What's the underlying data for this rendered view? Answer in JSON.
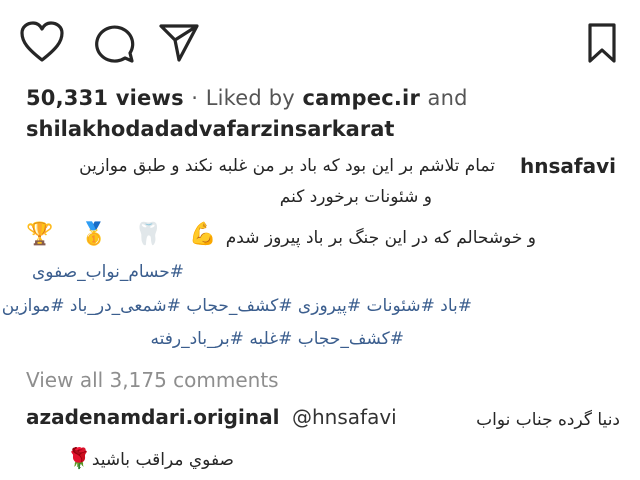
{
  "actions": {
    "like": "heart-icon",
    "comment": "comment-icon",
    "share": "share-icon",
    "save": "bookmark-icon"
  },
  "stats": {
    "views": "50,331 views",
    "separator": "·",
    "liked_by_prefix": "Liked by",
    "liked_by_user": "campec.ir",
    "and": "and",
    "liked_by_user2": "shilakhodadadvafarzinsarkarat"
  },
  "caption": {
    "username": "hnsafavi",
    "line1": "تمام تلاشم بر این بود که باد بر من غلبه نکند و طبق موازین",
    "line2": "و شئونات برخورد کنم",
    "line3": "و خوشحالم که در این جنگ بر باد پیروز شدم",
    "emojis": [
      "🏆",
      "🥇",
      "🦷",
      "💪"
    ],
    "hashtags_line1": "#حسام_نواب_صفوی",
    "hashtags_line2": "#باد #شئونات #پیروزی #کشف_حجاب #شمعی_در_باد #موازین",
    "hashtags_line3": "#کشف_حجاب #غلبه #بر_باد_رفته"
  },
  "comments": {
    "view_all": "View all 3,175 comments",
    "first": {
      "username": "azadenamdari.original",
      "mention": "@hnsafavi",
      "line1": "دنیا گرده جناب نواب",
      "line2": "صفوي مراقب باشيد",
      "emoji": "rose-emoji"
    }
  }
}
